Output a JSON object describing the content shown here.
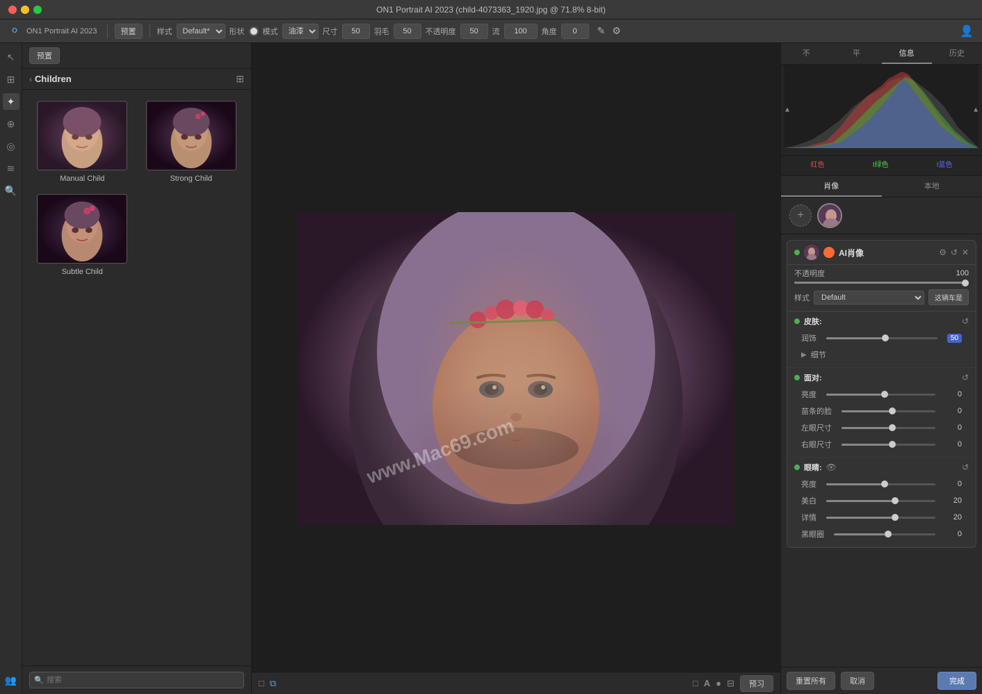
{
  "titlebar": {
    "title": "ON1 Portrait AI 2023 (child-4073363_1920.jpg @ 71.8% 8-bit)"
  },
  "toolbar": {
    "preset_label": "预置",
    "style_label": "样式",
    "style_value": "Default*",
    "shape_label": "形状",
    "mode_label": "模式",
    "mode_value": "油漆",
    "size_label": "尺寸",
    "size_value": "50",
    "feather_label": "羽毛",
    "feather_value": "50",
    "opacity_label": "不透明度",
    "opacity_value": "50",
    "flow_label": "流",
    "flow_value": "100",
    "angle_label": "角度",
    "angle_value": "0"
  },
  "presets": {
    "header": "Children",
    "items": [
      {
        "label": "Manual Child",
        "id": "manual-child"
      },
      {
        "label": "Strong Child",
        "id": "strong-child"
      },
      {
        "label": "Subtle Child",
        "id": "subtle-child"
      }
    ],
    "search_placeholder": "搜索"
  },
  "right_panel": {
    "tabs": [
      {
        "label": "不",
        "id": "tab-bu"
      },
      {
        "label": "平",
        "id": "tab-ping"
      },
      {
        "label": "信息",
        "id": "tab-info"
      },
      {
        "label": "历史",
        "id": "tab-history"
      }
    ],
    "hist_labels": {
      "red": "红色",
      "green": "I绿色",
      "blue": "I蓝色"
    },
    "portrait_tabs": [
      {
        "label": "肖像",
        "active": true
      },
      {
        "label": "本地",
        "active": false
      }
    ],
    "ai_module": {
      "title": "AI肖像",
      "opacity_label": "不透明度",
      "opacity_value": "100",
      "style_label": "样式",
      "style_value": "Default",
      "this_car_btn": "这辆车是"
    },
    "skin": {
      "label": "皮肤:",
      "润饰_label": "润饰",
      "润饰_value": "50",
      "细节_label": "细节"
    },
    "face": {
      "label": "面对:",
      "brightness_label": "亮度",
      "brightness_value": "0",
      "苗条的脸_label": "苗条的脸",
      "苗条的脸_value": "0",
      "左眼尺寸_label": "左眼尺寸",
      "左眼尺寸_value": "0",
      "右眼尺寸_label": "右眼尺寸",
      "右眼尺寸_value": "0"
    },
    "eyes": {
      "label": "眼睛:",
      "brightness_label": "亮度",
      "brightness_value": "0",
      "美白_label": "美白",
      "美白_value": "20",
      "详情_label": "详情",
      "详情_value": "20",
      "黑眼圈_label": "黑眼圈",
      "黑眼圈_value": "0"
    },
    "bottom_actions": {
      "reset_all": "重置所有",
      "cancel": "取消",
      "done": "完成"
    }
  },
  "watermark": "www.Mac69.com",
  "app_name": "ON1 Portrait AI 2023"
}
